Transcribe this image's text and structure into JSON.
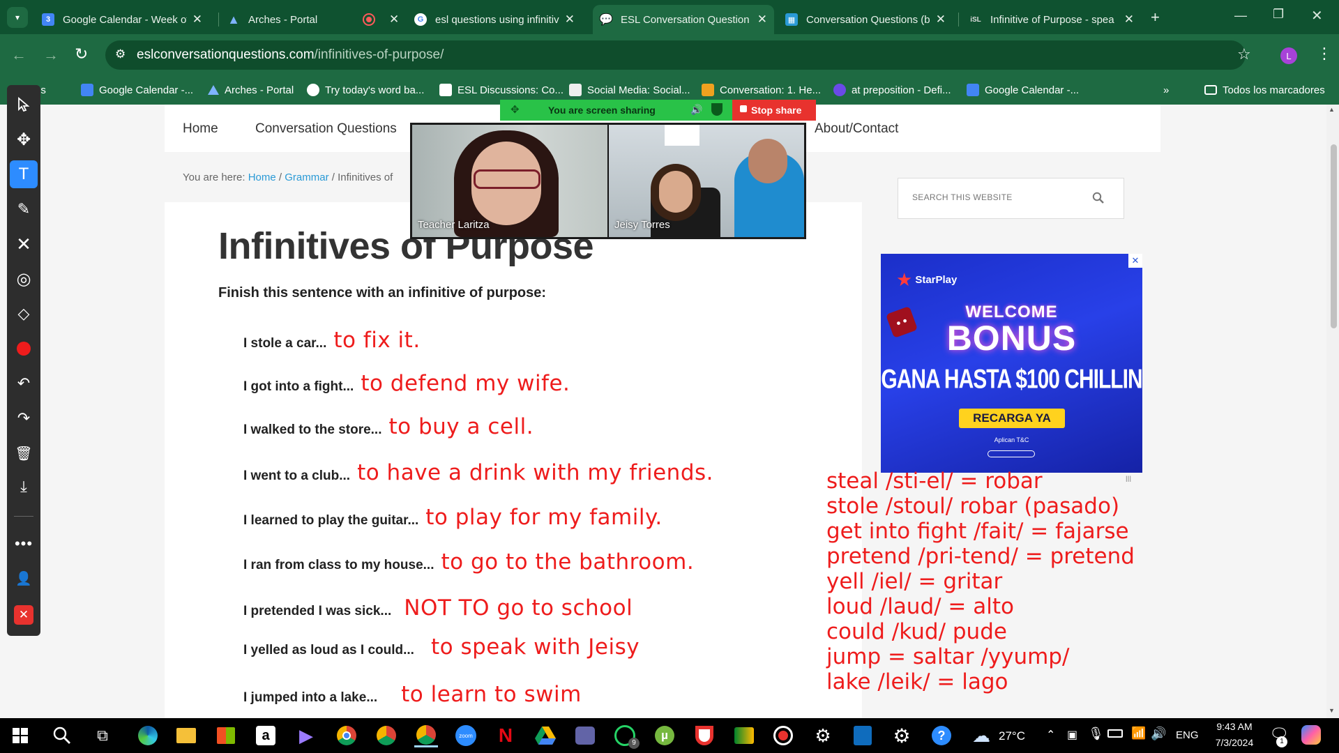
{
  "tabs": [
    {
      "title": "Google Calendar - Week of",
      "active": false
    },
    {
      "title": "Arches - Portal",
      "active": false
    },
    {
      "title": "",
      "active": false
    },
    {
      "title": "esl questions using infinitiv",
      "active": false
    },
    {
      "title": "ESL Conversation Question",
      "active": true
    },
    {
      "title": "Conversation Questions (b",
      "active": false
    },
    {
      "title": "Infinitive of Purpose - spea",
      "active": false
    }
  ],
  "address": {
    "domain": "eslconversationquestions.com",
    "path": "/infinitives-of-purpose/"
  },
  "profile_initial": "L",
  "bookmarks": [
    "es",
    "Google Calendar -...",
    "Arches - Portal",
    "Try today's word ba...",
    "ESL Discussions: Co...",
    "Social Media: Social...",
    "Conversation: 1. He...",
    "at preposition - Defi...",
    "Google Calendar -..."
  ],
  "bookmarks_all": "Todos los marcadores",
  "share": {
    "status": "You are screen sharing",
    "stop": "Stop share"
  },
  "video": {
    "left_name": "Teacher Laritza",
    "right_name": "Jeisy Torres"
  },
  "nav": [
    "Home",
    "Conversation Questions",
    "About/Contact"
  ],
  "breadcrumb": {
    "prefix": "You are here:",
    "home": "Home",
    "sep": "/",
    "grammar": "Grammar",
    "current": "Infinitives of"
  },
  "search_placeholder": "SEARCH THIS WEBSITE",
  "article": {
    "title": "Infinitives of Purpose",
    "instruction": "Finish this sentence with an infinitive of purpose:",
    "items": [
      {
        "q": "I stole a car...",
        "a": "to fix it."
      },
      {
        "q": "I got into a fight...",
        "a": "to defend my wife."
      },
      {
        "q": "I walked to the store...",
        "a": "to buy a cell."
      },
      {
        "q": "I went to a club...",
        "a": "to have a drink with my friends."
      },
      {
        "q": "I learned to play the guitar...",
        "a": "to play for my family."
      },
      {
        "q": "I ran from class to my house...",
        "a": "to go to the bathroom."
      },
      {
        "q": "I pretended I was sick...",
        "a": "NOT TO go to school"
      },
      {
        "q": "I yelled as loud as I could...",
        "a": "to speak with Jeisy"
      },
      {
        "q": "I jumped into a lake...",
        "a": "to learn to swim"
      }
    ]
  },
  "vocab": [
    "steal /sti-el/ = robar",
    "stole /stoul/ robar (pasado)",
    "get into fight /fait/ = fajarse",
    "pretend /pri-tend/ = pretend",
    "yell /iel/ = gritar",
    "loud /laud/ = alto",
    "could /kud/ pude",
    "jump = saltar /yyump/",
    "lake /leik/ = lago"
  ],
  "ad": {
    "brand": "StarPlay",
    "line1": "WELCOME",
    "line2": "BONUS",
    "line3": "GANA HASTA $100 CHILLIN",
    "cta": "RECARGA YA",
    "fine": "Aplican T&C",
    "close": "✕"
  },
  "taskbar": {
    "weather": "27°C",
    "lang": "ENG",
    "time": "9:43 AM",
    "date": "7/3/2024",
    "whatsapp_badge": "9",
    "notif_badge": "1"
  },
  "colors": {
    "accent_green": "#1e6a42",
    "annotation_red": "#ee1c1c",
    "link_blue": "#2a9ad6"
  }
}
